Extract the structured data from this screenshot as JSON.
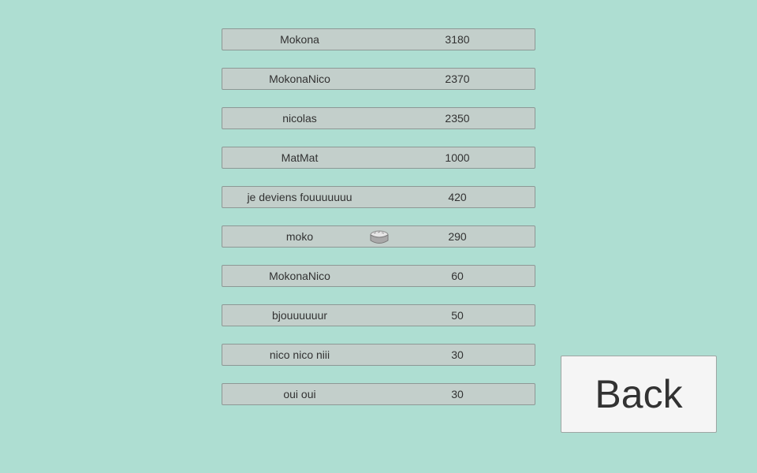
{
  "leaderboard": {
    "rows": [
      {
        "name": "Mokona",
        "score": "3180"
      },
      {
        "name": "MokonaNico",
        "score": "2370"
      },
      {
        "name": "nicolas",
        "score": "2350"
      },
      {
        "name": "MatMat",
        "score": "1000"
      },
      {
        "name": "je deviens fouuuuuuu",
        "score": "420"
      },
      {
        "name": "moko",
        "score": "290"
      },
      {
        "name": "MokonaNico",
        "score": "60"
      },
      {
        "name": "bjouuuuuur",
        "score": "50"
      },
      {
        "name": "nico nico niii",
        "score": "30"
      },
      {
        "name": "oui oui",
        "score": "30"
      }
    ]
  },
  "cursor": {
    "icon": "hand-cursor-icon"
  },
  "back_button": {
    "label": "Back"
  }
}
